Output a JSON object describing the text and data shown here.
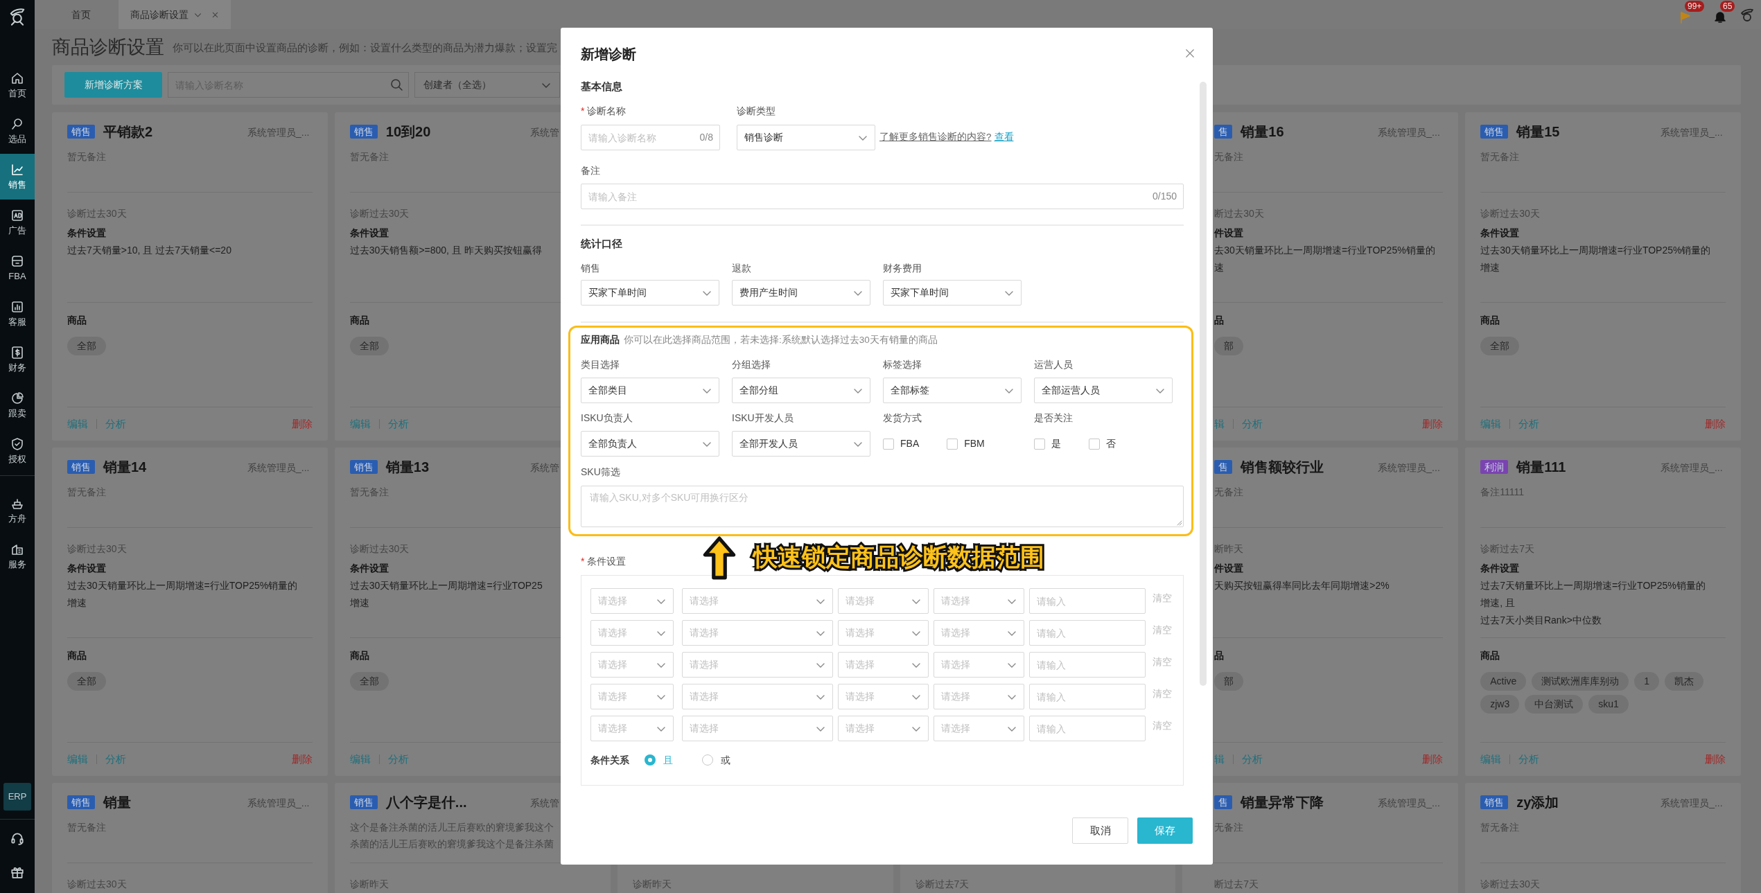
{
  "sidebar": {
    "items": [
      {
        "label": "首页",
        "selected": false
      },
      {
        "label": "选品",
        "selected": false
      },
      {
        "label": "销售",
        "selected": true
      },
      {
        "label": "广告",
        "selected": false
      },
      {
        "label": "FBA",
        "selected": false
      },
      {
        "label": "客服",
        "selected": false
      },
      {
        "label": "财务",
        "selected": false
      },
      {
        "label": "跟卖",
        "selected": false
      },
      {
        "label": "授权",
        "selected": false
      }
    ],
    "secondary_items": [
      {
        "label": "方舟",
        "selected": false
      },
      {
        "label": "服务",
        "selected": false
      }
    ],
    "erp": "ERP"
  },
  "tabs": [
    {
      "label": "首页",
      "selected": false,
      "closable": false
    },
    {
      "label": "商品诊断设置",
      "selected": true,
      "closable": true
    }
  ],
  "header_badges": {
    "flag": "99+",
    "bell": "65"
  },
  "page": {
    "title": "商品诊断设置",
    "description": "你可以在此页面中设置商品的诊断，例如：设置什么类型的商品为潜力爆款；设置完"
  },
  "toolbar": {
    "add_button": "新增诊断方案",
    "search_placeholder": "请输入诊断名称",
    "creator_filter": "创建者（全选）"
  },
  "card_columns": [
    [
      {
        "tag": {
          "label": "销售",
          "color": "#2a5db0"
        },
        "title": "平销款2",
        "creator": "系统管理员_...",
        "note_lines": [
          "暂无备注"
        ],
        "period": "诊断过去30天",
        "condition_heading": "条件设置",
        "condition_lines": [
          "过去7天销量>10, 且 过去7天销量<=20"
        ],
        "products_heading": "商品",
        "products": [
          "全部"
        ],
        "edit": "编辑",
        "analyze": "分析",
        "delete": "删除"
      },
      {
        "tag": {
          "label": "销售",
          "color": "#2a5db0"
        },
        "title": "销量14",
        "creator": "系统管理员_...",
        "note_lines": [
          "暂无备注"
        ],
        "period": "诊断过去30天",
        "condition_heading": "条件设置",
        "condition_lines": [
          "过去30天销量环比上一周期增速=行业TOP25%销量的",
          "增速"
        ],
        "products_heading": "商品",
        "products": [
          "全部"
        ],
        "edit": "编辑",
        "analyze": "分析",
        "delete": "删除"
      },
      {
        "tag": {
          "label": "销售",
          "color": "#2a5db0"
        },
        "title": "销量",
        "creator": "系统管理员_...",
        "note_lines": [
          "暂无备注"
        ],
        "period": "诊断过去30天"
      }
    ],
    [
      {
        "tag": {
          "label": "销售",
          "color": "#2a5db0"
        },
        "title": "10到20",
        "creator": "系统管",
        "note_lines": [
          "暂无备注"
        ],
        "period": "诊断过去30天",
        "condition_heading": "条件设置",
        "condition_lines": [
          "过去30天销售额>=800, 且 昨天购买按钮赢得"
        ],
        "products_heading": "商品",
        "products": [
          "全部"
        ],
        "edit": "编辑",
        "analyze": "分析"
      },
      {
        "tag": {
          "label": "销售",
          "color": "#2a5db0"
        },
        "title": "销量13",
        "creator": "系统管",
        "note_lines": [
          "暂无备注"
        ],
        "period": "诊断过去30天",
        "condition_heading": "条件设置",
        "condition_lines": [
          "过去30天销量环比上一周期增速=行业TOP25",
          "增速"
        ],
        "products_heading": "商品",
        "products": [
          "全部"
        ],
        "edit": "编辑",
        "analyze": "分析"
      },
      {
        "tag": {
          "label": "销售",
          "color": "#2a5db0"
        },
        "title": "八个字是什...",
        "creator": "系统管",
        "note_lines": [
          "这个是备注杀菌的活儿王后赛欧的窘境爹我这个",
          "杀菌的活儿王后赛欧的窘境爹我这个是备注杀菌"
        ],
        "period": "诊断昨天"
      }
    ],
    [
      {},
      {},
      {
        "period": "诊断昨天"
      }
    ],
    [
      {},
      {},
      {
        "period": "诊断过去7天"
      }
    ],
    [
      {
        "tag": {
          "label": "售",
          "color": "#2a5db0"
        },
        "title": "销量16",
        "creator": "系统管理员_...",
        "note_lines": [
          "无备注"
        ],
        "period": "断过去30天",
        "condition_heading": "件设置",
        "condition_lines": [
          "去30天销量环比上一周期增速=行业TOP25%销量的",
          "速"
        ],
        "products_heading": "品",
        "products": [
          "部"
        ],
        "edit": "辑",
        "analyze": "分析",
        "delete": "删除"
      },
      {
        "tag": {
          "label": "售",
          "color": "#2a5db0"
        },
        "title": "销售额较行业",
        "creator": "系统管理员_...",
        "note_lines": [
          "无备注"
        ],
        "period": "断昨天",
        "condition_heading": "件设置",
        "condition_lines": [
          "天购买按钮赢得率同比去年同期增速>2%"
        ],
        "products_heading": "品",
        "products": [
          "部"
        ],
        "edit": "辑",
        "analyze": "分析",
        "delete": "删除"
      },
      {
        "tag": {
          "label": "售",
          "color": "#2a5db0"
        },
        "title": "销量异常下降",
        "creator": "系统管理员_...",
        "note_lines": [
          "无备注"
        ],
        "period": "断过去7天"
      }
    ],
    [
      {
        "tag": {
          "label": "销售",
          "color": "#2a5db0"
        },
        "title": "销量15",
        "creator": "系统管理员_...",
        "note_lines": [
          "暂无备注"
        ],
        "period": "诊断过去30天",
        "condition_heading": "条件设置",
        "condition_lines": [
          "过去30天销量环比上一周期增速=行业TOP25%销量的",
          "增速"
        ],
        "products_heading": "商品",
        "products": [
          "全部"
        ],
        "edit": "编辑",
        "analyze": "分析",
        "delete": "删除"
      },
      {
        "tag": {
          "label": "利润",
          "color": "#7a44b0"
        },
        "title": "销量111",
        "creator": "系统管理员_...",
        "note_lines": [
          "备注11111"
        ],
        "period": "诊断过去7天",
        "condition_heading": "条件设置",
        "condition_lines": [
          "过去7天销量环比上一周期增速=行业TOP25%销量的",
          "增速, 且",
          "过去7天小类目Rank>中位数"
        ],
        "products_heading": "商品",
        "products": [
          "Active",
          "测试欧洲库库别动",
          "1",
          "凯杰",
          "zjw3",
          "中台测试",
          "sku1"
        ],
        "edit": "编辑",
        "analyze": "分析",
        "delete": "删除"
      },
      {
        "tag": {
          "label": "销售",
          "color": "#2a5db0"
        },
        "title": "zy添加",
        "creator": "系统管理员_...",
        "note_lines": [
          "暂无备注"
        ],
        "period": "诊断过去30天"
      }
    ]
  ],
  "modal": {
    "title": "新增诊断",
    "basic": {
      "heading": "基本信息",
      "name": {
        "label": "诊断名称",
        "required_mark": "*",
        "placeholder": "请输入诊断名称",
        "count": "0/8"
      },
      "type": {
        "label": "诊断类型",
        "value": "销售诊断"
      },
      "help_text": "了解更多销售诊断的内容?",
      "help_link": "查看",
      "remark": {
        "label": "备注",
        "placeholder": "请输入备注",
        "count": "0/150"
      }
    },
    "statistics": {
      "heading": "统计口径",
      "fields": [
        {
          "label": "销售",
          "value": "买家下单时间"
        },
        {
          "label": "退款",
          "value": "费用产生时间"
        },
        {
          "label": "财务费用",
          "value": "买家下单时间"
        }
      ]
    },
    "products": {
      "heading": "应用商品",
      "hint": "你可以在此选择商品范围，若未选择:系统默认选择过去30天有销量的商品",
      "fields": [
        {
          "kind": "select",
          "label": "类目选择",
          "value": "全部类目"
        },
        {
          "kind": "select",
          "label": "分组选择",
          "value": "全部分组"
        },
        {
          "kind": "select",
          "label": "标签选择",
          "value": "全部标签"
        },
        {
          "kind": "select",
          "label": "运营人员",
          "value": "全部运营人员"
        },
        {
          "kind": "select",
          "label": "ISKU负责人",
          "value": "全部负责人"
        },
        {
          "kind": "select",
          "label": "ISKU开发人员",
          "value": "全部开发人员"
        },
        {
          "kind": "checkboxes",
          "label": "发货方式",
          "options": [
            {
              "label": "FBA",
              "checked": false
            },
            {
              "label": "FBM",
              "checked": false
            }
          ]
        },
        {
          "kind": "checkboxes",
          "label": "是否关注",
          "options": [
            {
              "label": "是",
              "checked": false
            },
            {
              "label": "否",
              "checked": false
            }
          ]
        }
      ],
      "sku": {
        "label": "SKU筛选",
        "placeholder": "请输入SKU,对多个SKU可用换行区分"
      }
    },
    "annotation": "快速锁定商品诊断数据范围",
    "conditions": {
      "label": "条件设置",
      "required_mark": "*",
      "rows": [
        {
          "placeholders": [
            "请选择",
            "请选择",
            "请选择",
            "请选择"
          ],
          "placeholder": "请输入",
          "clear": "清空"
        },
        {
          "placeholders": [
            "请选择",
            "请选择",
            "请选择",
            "请选择"
          ],
          "placeholder": "请输入",
          "clear": "清空"
        },
        {
          "placeholders": [
            "请选择",
            "请选择",
            "请选择",
            "请选择"
          ],
          "placeholder": "请输入",
          "clear": "清空"
        },
        {
          "placeholders": [
            "请选择",
            "请选择",
            "请选择",
            "请选择"
          ],
          "placeholder": "请输入",
          "clear": "清空"
        },
        {
          "placeholders": [
            "请选择",
            "请选择",
            "请选择",
            "请选择"
          ],
          "placeholder": "请输入",
          "clear": "清空"
        }
      ],
      "relation": {
        "label": "条件关系",
        "options": [
          {
            "label": "且",
            "selected": true
          },
          {
            "label": "或",
            "selected": false
          }
        ]
      }
    },
    "buttons": [
      {
        "label": "取消",
        "kind": "secondary"
      },
      {
        "label": "保存",
        "kind": "primary"
      }
    ]
  }
}
